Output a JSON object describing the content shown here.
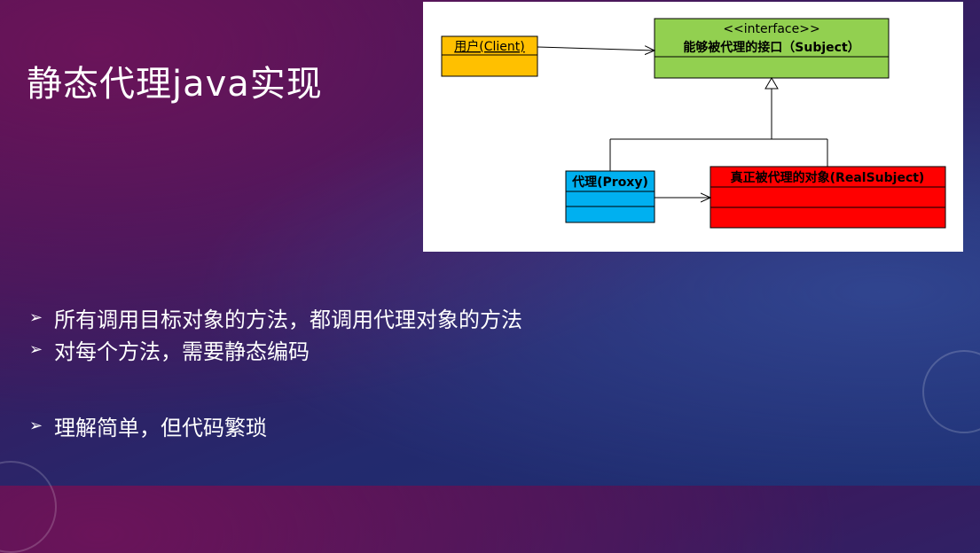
{
  "slide": {
    "title": "静态代理java实现"
  },
  "diagram": {
    "client": {
      "label": "用户(Client)",
      "color": "#ffc000"
    },
    "interface": {
      "stereotype": "<<interface>>",
      "label": "能够被代理的接口（Subject）",
      "color": "#92d050"
    },
    "proxy": {
      "label": "代理(Proxy)",
      "color": "#00b0f0"
    },
    "real_subject": {
      "label": "真正被代理的对象(RealSubject)",
      "color": "#ff0000"
    }
  },
  "bullets": [
    {
      "icon": "arrow-bullet-icon",
      "text": "所有调用目标对象的方法，都调用代理对象的方法"
    },
    {
      "icon": "arrow-bullet-icon",
      "text": "对每个方法，需要静态编码"
    },
    {
      "icon": "arrow-bullet-icon",
      "text": "理解简单，但代码繁琐"
    }
  ]
}
